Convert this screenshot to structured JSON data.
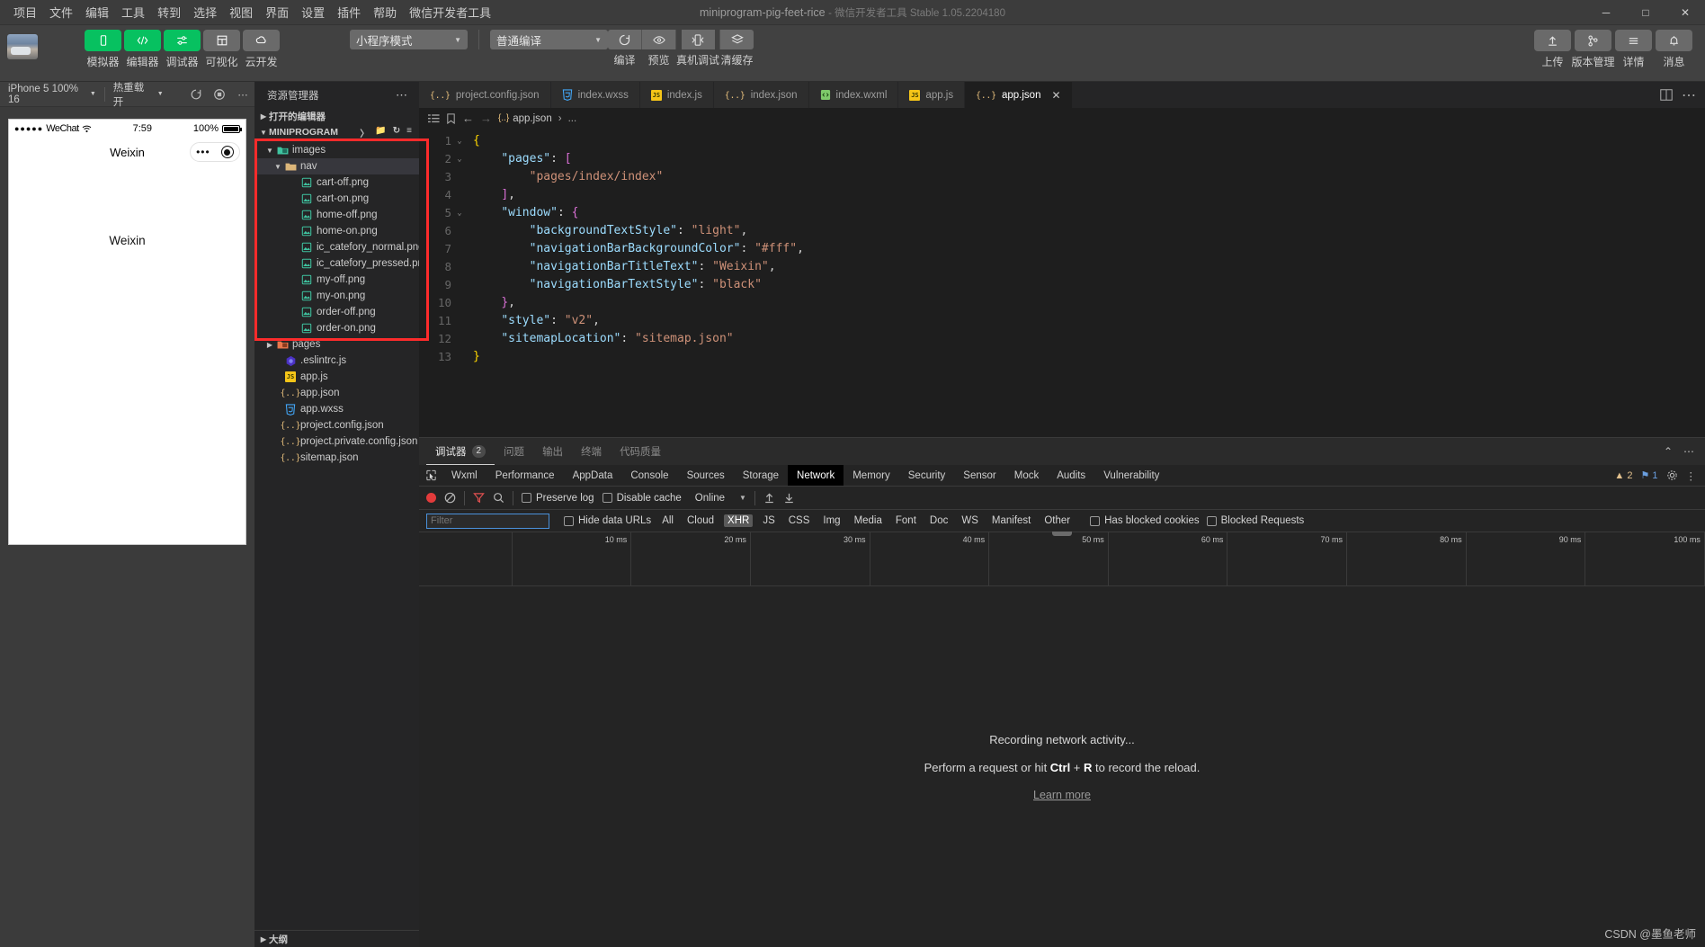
{
  "titlebar": {
    "menus": [
      "项目",
      "文件",
      "编辑",
      "工具",
      "转到",
      "选择",
      "视图",
      "界面",
      "设置",
      "插件",
      "帮助",
      "微信开发者工具"
    ],
    "project_title": "miniprogram-pig-feet-rice",
    "app_sub": "- 微信开发者工具 Stable 1.05.2204180",
    "minimize": "─",
    "maximize": "□",
    "close": "✕"
  },
  "toolbar": {
    "left_buttons": [
      {
        "label": "模拟器",
        "style": "green",
        "icon": "phone-icon"
      },
      {
        "label": "编辑器",
        "style": "green",
        "icon": "code-icon"
      },
      {
        "label": "调试器",
        "style": "green",
        "icon": "sliders-icon"
      },
      {
        "label": "可视化",
        "style": "grey",
        "icon": "layout-icon"
      },
      {
        "label": "云开发",
        "style": "grey",
        "icon": "cloud-icon"
      }
    ],
    "mode_select": "小程序模式",
    "compile_select": "普通编译",
    "segments": [
      {
        "label": "编译",
        "icon": "refresh-icon"
      },
      {
        "label": "预览",
        "icon": "eye-icon"
      },
      {
        "label": "真机调试",
        "icon": "device-debug-icon"
      },
      {
        "label": "清缓存",
        "icon": "stack-icon"
      }
    ],
    "right_buttons": [
      {
        "label": "上传",
        "icon": "upload-icon"
      },
      {
        "label": "版本管理",
        "icon": "branch-icon"
      },
      {
        "label": "详情",
        "icon": "menu-icon"
      },
      {
        "label": "消息",
        "icon": "bell-icon"
      }
    ]
  },
  "simulator": {
    "device": "iPhone 5 100% 16",
    "hotreload": "热重载 开",
    "icons": [
      "refresh-icon",
      "record-icon",
      "more-icon"
    ],
    "phone": {
      "carrier": "WeChat",
      "signal_dots": "●●●●●",
      "time": "7:59",
      "battery_pct": "100%",
      "nav_title": "Weixin",
      "capsule_dots": "•••",
      "page_text": "Weixin"
    }
  },
  "explorer": {
    "title": "资源管理器",
    "more": "⋯",
    "open_editors": "打开的编辑器",
    "project_root": "MINIPROGRAM",
    "outline": "大纲",
    "tree": [
      {
        "label": "images",
        "indent": 1,
        "icon": "folder-images-icon",
        "type": "folder",
        "expanded": true,
        "selected": false
      },
      {
        "label": "nav",
        "indent": 2,
        "icon": "folder-icon",
        "type": "folder",
        "expanded": true,
        "selected": true
      },
      {
        "label": "cart-off.png",
        "indent": 4,
        "icon": "image-file-icon",
        "type": "file"
      },
      {
        "label": "cart-on.png",
        "indent": 4,
        "icon": "image-file-icon",
        "type": "file"
      },
      {
        "label": "home-off.png",
        "indent": 4,
        "icon": "image-file-icon",
        "type": "file"
      },
      {
        "label": "home-on.png",
        "indent": 4,
        "icon": "image-file-icon",
        "type": "file"
      },
      {
        "label": "ic_catefory_normal.png",
        "indent": 4,
        "icon": "image-file-icon",
        "type": "file"
      },
      {
        "label": "ic_catefory_pressed.png",
        "indent": 4,
        "icon": "image-file-icon",
        "type": "file"
      },
      {
        "label": "my-off.png",
        "indent": 4,
        "icon": "image-file-icon",
        "type": "file"
      },
      {
        "label": "my-on.png",
        "indent": 4,
        "icon": "image-file-icon",
        "type": "file"
      },
      {
        "label": "order-off.png",
        "indent": 4,
        "icon": "image-file-icon",
        "type": "file"
      },
      {
        "label": "order-on.png",
        "indent": 4,
        "icon": "image-file-icon",
        "type": "file"
      },
      {
        "label": "pages",
        "indent": 1,
        "icon": "folder-pages-icon",
        "type": "folder",
        "expanded": false
      },
      {
        "label": ".eslintrc.js",
        "indent": 2,
        "icon": "eslint-icon",
        "type": "file"
      },
      {
        "label": "app.js",
        "indent": 2,
        "icon": "js-icon",
        "type": "file"
      },
      {
        "label": "app.json",
        "indent": 2,
        "icon": "json-icon",
        "type": "file"
      },
      {
        "label": "app.wxss",
        "indent": 2,
        "icon": "wxss-icon",
        "type": "file"
      },
      {
        "label": "project.config.json",
        "indent": 2,
        "icon": "json-icon",
        "type": "file"
      },
      {
        "label": "project.private.config.json",
        "indent": 2,
        "icon": "json-icon",
        "type": "file"
      },
      {
        "label": "sitemap.json",
        "indent": 2,
        "icon": "json-icon",
        "type": "file"
      }
    ]
  },
  "editor": {
    "tabs": [
      {
        "label": "project.config.json",
        "icon": "json-icon",
        "active": false
      },
      {
        "label": "index.wxss",
        "icon": "wxss-icon",
        "active": false
      },
      {
        "label": "index.js",
        "icon": "js-icon",
        "active": false
      },
      {
        "label": "index.json",
        "icon": "json-icon",
        "active": false
      },
      {
        "label": "index.wxml",
        "icon": "wxml-icon",
        "active": false
      },
      {
        "label": "app.js",
        "icon": "js-icon",
        "active": false
      },
      {
        "label": "app.json",
        "icon": "json-icon",
        "active": true
      }
    ],
    "close_glyph": "✕",
    "breadcrumb": {
      "file": "app.json",
      "sep": "›",
      "rest": "..."
    },
    "lines": [
      {
        "n": "1",
        "fold": "⌄",
        "segs": [
          {
            "t": "{",
            "c": "k-punc"
          }
        ]
      },
      {
        "n": "2",
        "fold": "⌄",
        "segs": [
          {
            "t": "    ",
            "c": ""
          },
          {
            "t": "\"pages\"",
            "c": "k-key"
          },
          {
            "t": ": ",
            "c": "k-col"
          },
          {
            "t": "[",
            "c": "k-brk"
          }
        ]
      },
      {
        "n": "3",
        "fold": "",
        "segs": [
          {
            "t": "        ",
            "c": ""
          },
          {
            "t": "\"pages/index/index\"",
            "c": "k-str"
          }
        ]
      },
      {
        "n": "4",
        "fold": "",
        "segs": [
          {
            "t": "    ",
            "c": ""
          },
          {
            "t": "]",
            "c": "k-brk"
          },
          {
            "t": ",",
            "c": "k-col"
          }
        ]
      },
      {
        "n": "5",
        "fold": "⌄",
        "segs": [
          {
            "t": "    ",
            "c": ""
          },
          {
            "t": "\"window\"",
            "c": "k-key"
          },
          {
            "t": ": ",
            "c": "k-col"
          },
          {
            "t": "{",
            "c": "k-brk"
          }
        ]
      },
      {
        "n": "6",
        "fold": "",
        "segs": [
          {
            "t": "        ",
            "c": ""
          },
          {
            "t": "\"backgroundTextStyle\"",
            "c": "k-key"
          },
          {
            "t": ": ",
            "c": "k-col"
          },
          {
            "t": "\"light\"",
            "c": "k-str"
          },
          {
            "t": ",",
            "c": "k-col"
          }
        ]
      },
      {
        "n": "7",
        "fold": "",
        "segs": [
          {
            "t": "        ",
            "c": ""
          },
          {
            "t": "\"navigationBarBackgroundColor\"",
            "c": "k-key"
          },
          {
            "t": ": ",
            "c": "k-col"
          },
          {
            "t": "\"#fff\"",
            "c": "k-str"
          },
          {
            "t": ",",
            "c": "k-col"
          }
        ]
      },
      {
        "n": "8",
        "fold": "",
        "segs": [
          {
            "t": "        ",
            "c": ""
          },
          {
            "t": "\"navigationBarTitleText\"",
            "c": "k-key"
          },
          {
            "t": ": ",
            "c": "k-col"
          },
          {
            "t": "\"Weixin\"",
            "c": "k-str"
          },
          {
            "t": ",",
            "c": "k-col"
          }
        ]
      },
      {
        "n": "9",
        "fold": "",
        "segs": [
          {
            "t": "        ",
            "c": ""
          },
          {
            "t": "\"navigationBarTextStyle\"",
            "c": "k-key"
          },
          {
            "t": ": ",
            "c": "k-col"
          },
          {
            "t": "\"black\"",
            "c": "k-str"
          }
        ]
      },
      {
        "n": "10",
        "fold": "",
        "segs": [
          {
            "t": "    ",
            "c": ""
          },
          {
            "t": "}",
            "c": "k-brk"
          },
          {
            "t": ",",
            "c": "k-col"
          }
        ]
      },
      {
        "n": "11",
        "fold": "",
        "segs": [
          {
            "t": "    ",
            "c": ""
          },
          {
            "t": "\"style\"",
            "c": "k-key"
          },
          {
            "t": ": ",
            "c": "k-col"
          },
          {
            "t": "\"v2\"",
            "c": "k-str"
          },
          {
            "t": ",",
            "c": "k-col"
          }
        ]
      },
      {
        "n": "12",
        "fold": "",
        "segs": [
          {
            "t": "    ",
            "c": ""
          },
          {
            "t": "\"sitemapLocation\"",
            "c": "k-key"
          },
          {
            "t": ": ",
            "c": "k-col"
          },
          {
            "t": "\"sitemap.json\"",
            "c": "k-str"
          }
        ]
      },
      {
        "n": "13",
        "fold": "",
        "segs": [
          {
            "t": "}",
            "c": "k-punc"
          }
        ]
      }
    ]
  },
  "devtools": {
    "top_tabs": [
      {
        "label": "调试器",
        "badge": "2",
        "active": true
      },
      {
        "label": "问题",
        "badge": "",
        "active": false
      },
      {
        "label": "输出",
        "badge": "",
        "active": false
      },
      {
        "label": "终端",
        "badge": "",
        "active": false
      },
      {
        "label": "代码质量",
        "badge": "",
        "active": false
      }
    ],
    "collapse_icon": "⌃",
    "more_icon": "⋯",
    "panels": [
      "Wxml",
      "Performance",
      "AppData",
      "Console",
      "Sources",
      "Storage",
      "Network",
      "Memory",
      "Security",
      "Sensor",
      "Mock",
      "Audits",
      "Vulnerability"
    ],
    "active_panel": "Network",
    "warning_count": "2",
    "error_count": "1",
    "network": {
      "preserve_log": "Preserve log",
      "disable_cache": "Disable cache",
      "throttle": "Online",
      "filter_placeholder": "Filter",
      "hide_data_urls": "Hide data URLs",
      "types": [
        "All",
        "Cloud",
        "XHR",
        "JS",
        "CSS",
        "Img",
        "Media",
        "Font",
        "Doc",
        "WS",
        "Manifest",
        "Other"
      ],
      "selected_type": "XHR",
      "has_blocked_cookies": "Has blocked cookies",
      "blocked_requests": "Blocked Requests",
      "timeline_ticks": [
        "10 ms",
        "20 ms",
        "30 ms",
        "40 ms",
        "50 ms",
        "60 ms",
        "70 ms",
        "80 ms",
        "90 ms",
        "100 ms"
      ],
      "empty_line1": "Recording network activity...",
      "empty_line2_pre": "Perform a request or hit ",
      "empty_line2_key1": "Ctrl",
      "empty_line2_plus": " + ",
      "empty_line2_key2": "R",
      "empty_line2_post": " to record the reload.",
      "empty_learn_more": "Learn more"
    }
  },
  "watermark": "CSDN @墨鱼老师",
  "colors": {
    "accent_green": "#07c160",
    "highlight_red": "#fc2b2b",
    "link_blue": "#4a90d9"
  }
}
